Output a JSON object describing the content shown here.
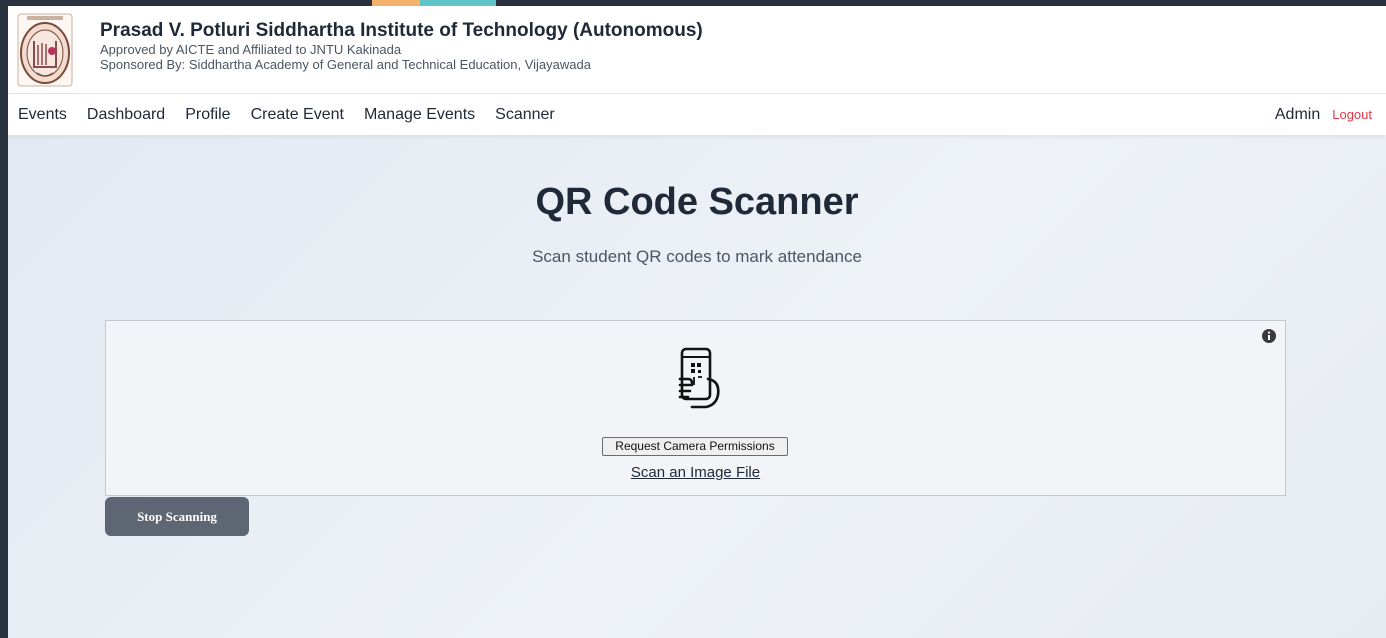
{
  "header": {
    "institute_name": "Prasad V. Potluri Siddhartha Institute of Technology (Autonomous)",
    "approval": "Approved by AICTE and Affiliated to JNTU Kakinada",
    "sponsor": "Sponsored By: Siddhartha Academy of General and Technical Education, Vijayawada"
  },
  "nav": {
    "items": [
      {
        "label": "Events"
      },
      {
        "label": "Dashboard"
      },
      {
        "label": "Profile"
      },
      {
        "label": "Create Event"
      },
      {
        "label": "Manage Events"
      },
      {
        "label": "Scanner"
      }
    ],
    "user": "Admin",
    "logout": "Logout"
  },
  "main": {
    "title": "QR Code Scanner",
    "subtitle": "Scan student QR codes to mark attendance",
    "scanner": {
      "info_icon": "info-icon",
      "illustration_icon": "phone-qr-scan-icon",
      "camera_button": "Request Camera Permissions",
      "scan_file_link": "Scan an Image File"
    },
    "stop_button": "Stop Scanning"
  },
  "colors": {
    "logout": "#e0394a",
    "stop_button": "#5f6673",
    "frame": "#2b3340",
    "title": "#1f2937"
  }
}
